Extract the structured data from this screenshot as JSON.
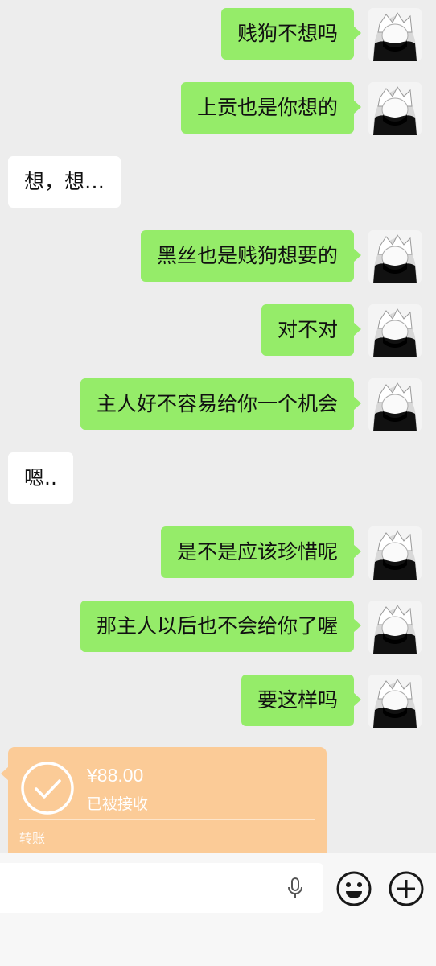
{
  "messages": [
    {
      "side": "out",
      "text": "贱狗不想吗"
    },
    {
      "side": "out",
      "text": "上贡也是你想的"
    },
    {
      "side": "in",
      "text": "想，想…"
    },
    {
      "side": "out",
      "text": "黑丝也是贱狗想要的"
    },
    {
      "side": "out",
      "text": "对不对"
    },
    {
      "side": "out",
      "text": "主人好不容易给你一个机会"
    },
    {
      "side": "in",
      "text": "嗯.."
    },
    {
      "side": "out",
      "text": "是不是应该珍惜呢"
    },
    {
      "side": "out",
      "text": "那主人以后也不会给你了喔"
    },
    {
      "side": "out",
      "text": "要这样吗"
    }
  ],
  "transfer": {
    "amount": "¥88.00",
    "status": "已被接收",
    "label": "转账"
  },
  "input_bar": {
    "icons": [
      "microphone-icon",
      "emoji-icon",
      "plus-icon"
    ]
  },
  "colors": {
    "background": "#ededed",
    "outgoing_bubble": "#95ec69",
    "incoming_bubble": "#ffffff",
    "transfer_card": "#fbcb97"
  }
}
